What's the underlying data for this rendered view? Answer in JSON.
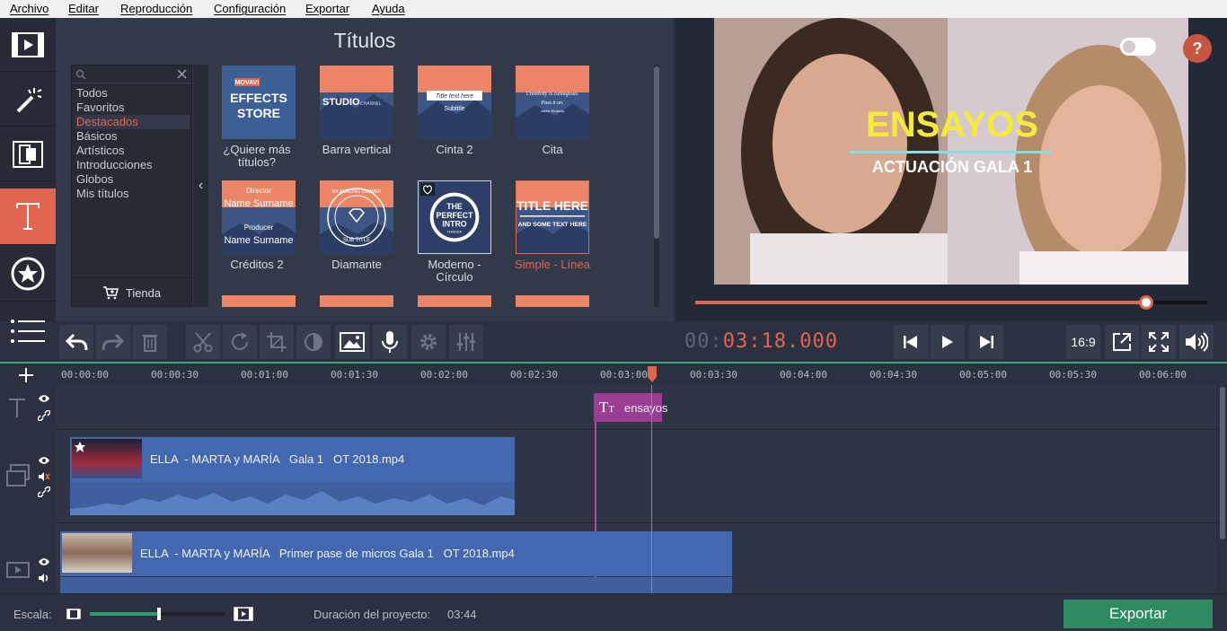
{
  "menu": [
    "Archivo",
    "Editar",
    "Reproducción",
    "Configuración",
    "Exportar",
    "Ayuda"
  ],
  "sidebar": {
    "items": [
      "import-media-icon",
      "filters-wand-icon",
      "transitions-icon",
      "titles-icon",
      "stickers-star-icon",
      "more-tools-list-icon"
    ],
    "active": "titles-icon"
  },
  "titles_panel": {
    "heading": "Títulos",
    "search_placeholder": "",
    "categories": [
      "Todos",
      "Favoritos",
      "Destacados",
      "Básicos",
      "Artísticos",
      "Introducciones",
      "Globos",
      "Mis títulos"
    ],
    "active_category": "Destacados",
    "store_label": "Tienda",
    "thumbnails": [
      {
        "label": "¿Quiere más títulos?",
        "art": [
          "MOVAVI",
          "EFFECTS",
          "STORE"
        ]
      },
      {
        "label": "Barra vertical",
        "art": [
          "STUDIO",
          "CHANNEL"
        ]
      },
      {
        "label": "Cinta 2",
        "art": [
          "Title text here",
          "Subtitle"
        ]
      },
      {
        "label": "Cita",
        "art": [
          "Creativity is contagious.",
          "Pass it on.",
          "Albert Einstein"
        ]
      },
      {
        "label": "Créditos 2",
        "art": [
          "Director",
          "Name Surname",
          "Producer",
          "Name Surname"
        ]
      },
      {
        "label": "Diamante",
        "art": [
          "MY AMAZING SUMMER",
          "SUB TITLE"
        ]
      },
      {
        "label": "Moderno - Círculo",
        "art": [
          "THE",
          "PERFECT",
          "INTRO",
          "FOREVER"
        ]
      },
      {
        "label": "Simple - Línea",
        "art": [
          "TITLE HERE",
          "AND SOME TEXT HERE"
        ]
      }
    ],
    "selected": "Simple - Línea"
  },
  "preview": {
    "title_main": "ENSAYOS",
    "title_sub": "ACTUACIÓN GALA 1",
    "help": "?",
    "progress": 0.88
  },
  "player": {
    "timecode_dim": "00:",
    "timecode_active": "03:18.000",
    "aspect": "16:9"
  },
  "timeline": {
    "ticks": [
      "00:00:00",
      "00:00:30",
      "00:01:00",
      "00:01:30",
      "00:02:00",
      "00:02:30",
      "00:03:00",
      "00:03:30",
      "00:04:00",
      "00:04:30",
      "00:05:00",
      "00:05:30",
      "00:06:00"
    ],
    "title_clip": "ensayos",
    "clip1": "ELLA  - MARTA y MARÍA   Gala 1   OT 2018.mp4",
    "clip2": "ELLA  - MARTA y MARÍA   Primer pase de micros Gala 1   OT 2018.mp4"
  },
  "status": {
    "scale_label": "Escala:",
    "scale_value": 0.51,
    "duration_label": "Duración del proyecto:",
    "duration_value": "03:44",
    "export_label": "Exportar"
  },
  "colors": {
    "accent": "#e0664f",
    "export": "#2e8a5f",
    "clip": "#4468b0",
    "title_clip": "#9a3d95"
  }
}
